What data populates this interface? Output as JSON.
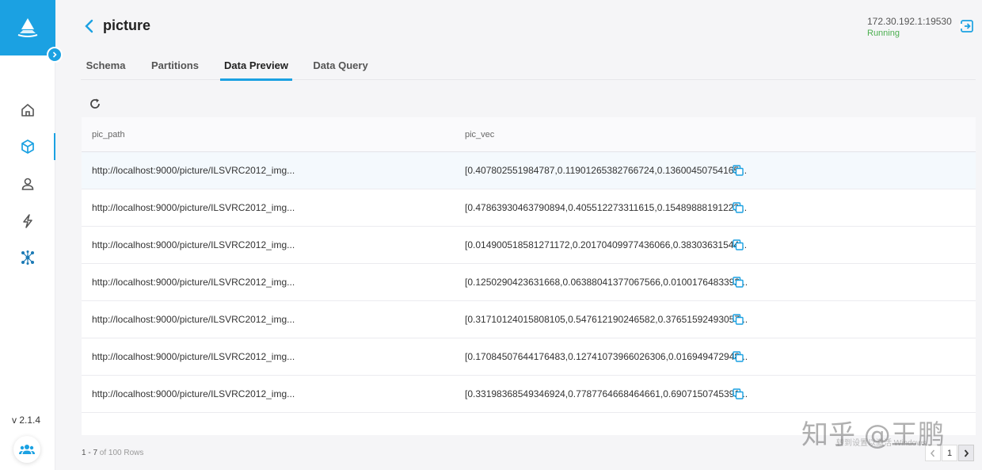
{
  "app": {
    "logo_icon": "milvus-logo-icon",
    "brand_color": "#1ba1e2",
    "version": "v 2.1.4"
  },
  "sidebar": {
    "items": [
      {
        "icon": "home-icon",
        "active": false
      },
      {
        "icon": "cube-icon",
        "active": true
      },
      {
        "icon": "user-icon",
        "active": false
      },
      {
        "icon": "lightning-icon",
        "active": false
      },
      {
        "icon": "cluster-icon",
        "active": false
      }
    ]
  },
  "header": {
    "title": "picture",
    "server_address": "172.30.192.1:19530",
    "server_status": "Running",
    "status_color": "#4caf50"
  },
  "tabs": [
    {
      "label": "Schema",
      "active": false
    },
    {
      "label": "Partitions",
      "active": false
    },
    {
      "label": "Data Preview",
      "active": true
    },
    {
      "label": "Data Query",
      "active": false
    }
  ],
  "table": {
    "columns": [
      "pic_path",
      "pic_vec"
    ],
    "rows": [
      {
        "pic_path": "http://localhost:9000/picture/ILSVRC2012_img...",
        "pic_vec": "[0.407802551984787,0.11901265382766724,0.13600450754165..."
      },
      {
        "pic_path": "http://localhost:9000/picture/ILSVRC2012_img...",
        "pic_vec": "[0.47863930463790894,0.405512273311615,0.15489888191223..."
      },
      {
        "pic_path": "http://localhost:9000/picture/ILSVRC2012_img...",
        "pic_vec": "[0.014900518581271172,0.20170409977436066,0.38303631544..."
      },
      {
        "pic_path": "http://localhost:9000/picture/ILSVRC2012_img...",
        "pic_vec": "[0.1250290423631668,0.06388041377067566,0.0100176483392..."
      },
      {
        "pic_path": "http://localhost:9000/picture/ILSVRC2012_img...",
        "pic_vec": "[0.31710124015808105,0.547612190246582,0.37651592493057..."
      },
      {
        "pic_path": "http://localhost:9000/picture/ILSVRC2012_img...",
        "pic_vec": "[0.17084507644176483,0.12741073966026306,0.016949472948..."
      },
      {
        "pic_path": "http://localhost:9000/picture/ILSVRC2012_img...",
        "pic_vec": "[0.33198368549346924,0.7787764668464661,0.6907150745391..."
      }
    ]
  },
  "footer": {
    "range": "1 - 7",
    "total": "of 100 Rows",
    "current_page": "1"
  },
  "watermark": {
    "text": "知乎 @王鹏",
    "sub": "转到设置以激活 Windows"
  }
}
